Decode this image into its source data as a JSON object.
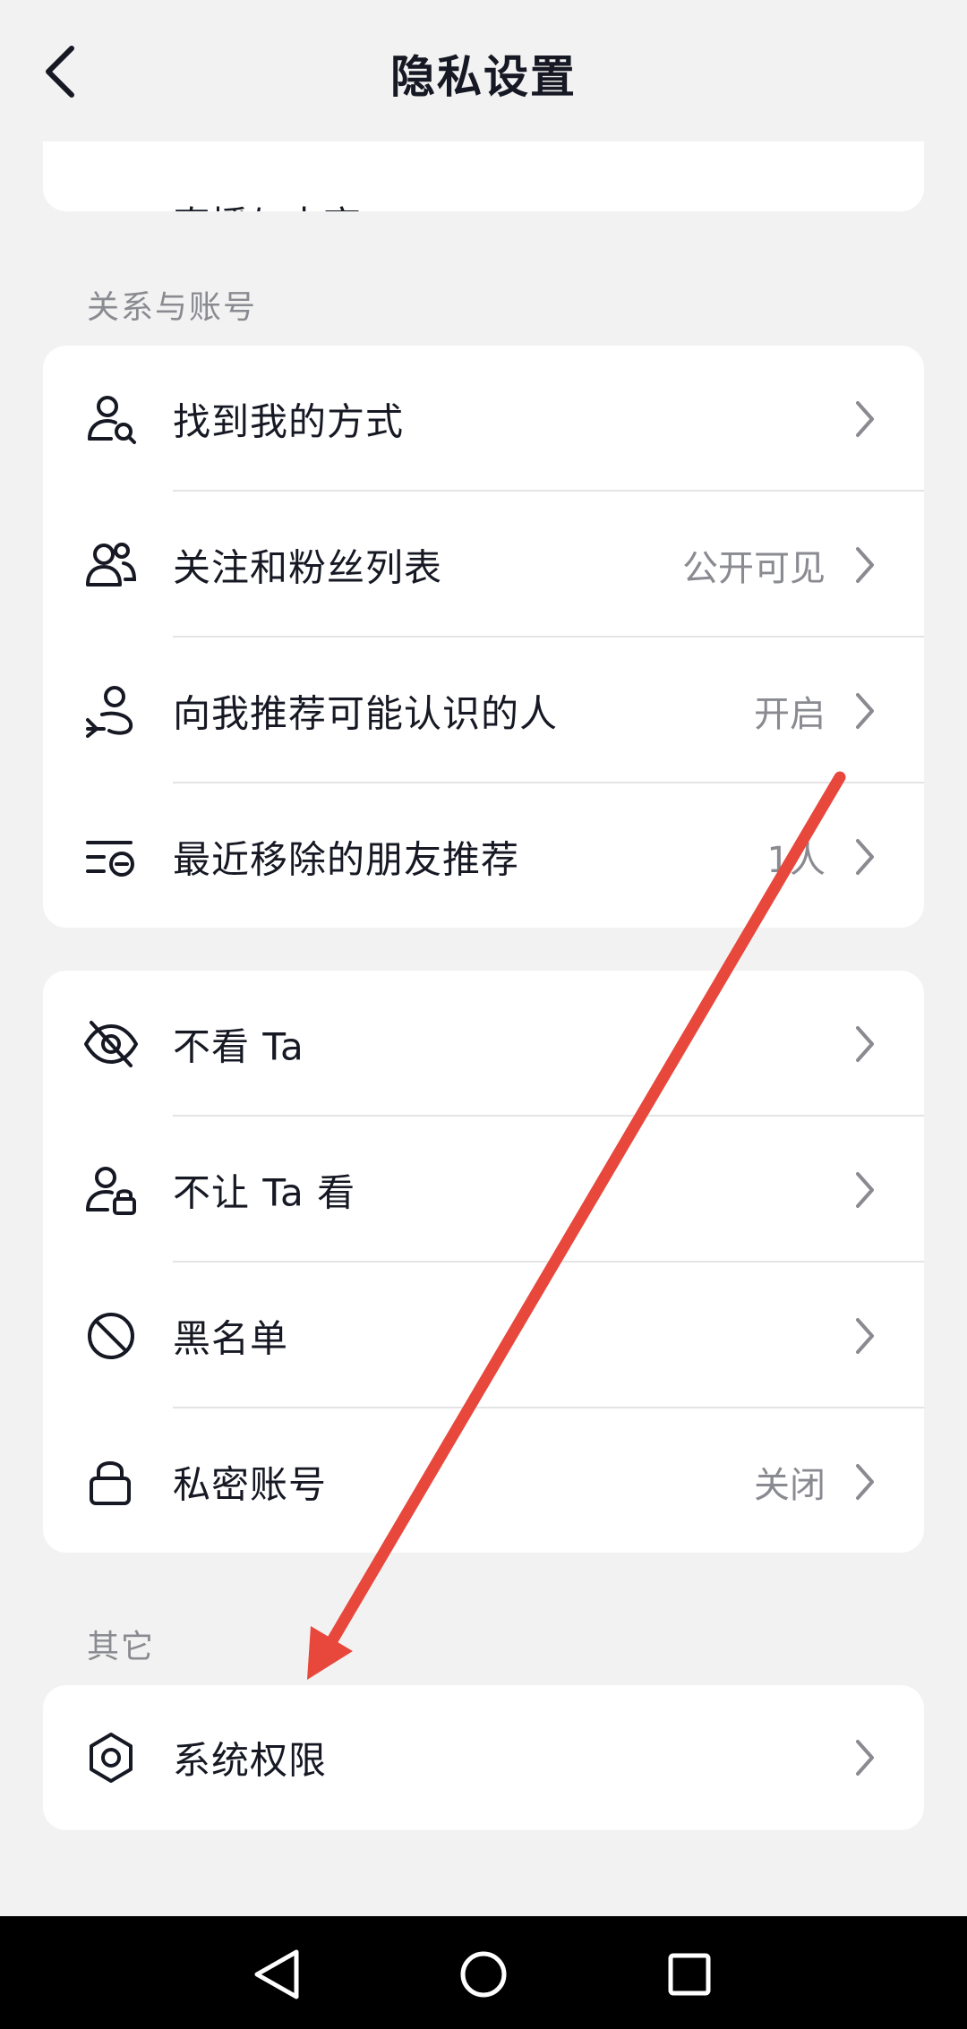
{
  "header": {
    "title": "隐私设置"
  },
  "partial_card": {
    "label": "直播与电商"
  },
  "sections": [
    {
      "label": "关系与账号"
    },
    {
      "label": ""
    },
    {
      "label": "其它"
    }
  ],
  "relations": {
    "items": [
      {
        "label": "找到我的方式",
        "value": "",
        "icon": "person-search-icon"
      },
      {
        "label": "关注和粉丝列表",
        "value": "公开可见",
        "icon": "people-icon"
      },
      {
        "label": "向我推荐可能认识的人",
        "value": "开启",
        "icon": "person-recommend-icon"
      },
      {
        "label": "最近移除的朋友推荐",
        "value": "1人",
        "icon": "list-remove-icon"
      }
    ]
  },
  "blocking": {
    "items": [
      {
        "label": "不看 Ta",
        "value": "",
        "icon": "eye-off-icon"
      },
      {
        "label": "不让 Ta 看",
        "value": "",
        "icon": "person-lock-icon"
      },
      {
        "label": "黑名单",
        "value": "",
        "icon": "block-icon"
      },
      {
        "label": "私密账号",
        "value": "关闭",
        "icon": "lock-icon"
      }
    ]
  },
  "other": {
    "items": [
      {
        "label": "系统权限",
        "value": "",
        "icon": "hexagon-settings-icon"
      }
    ]
  },
  "colors": {
    "background": "#f2f2f2",
    "card": "#ffffff",
    "text": "#161823",
    "secondary_text": "#8a8b91",
    "annotation_arrow": "#e8473c",
    "navbar": "#000000"
  }
}
